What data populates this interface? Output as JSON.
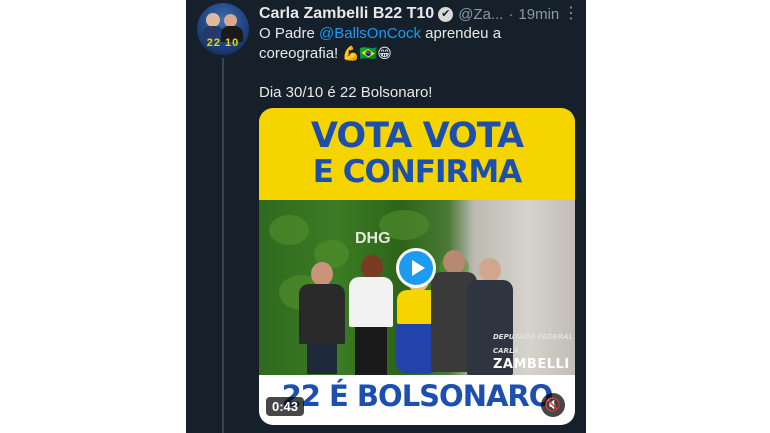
{
  "tweet": {
    "author_name": "Carla Zambelli B22 T10",
    "handle": "@Za...",
    "separator": "·",
    "time": "19min",
    "more_label": "⋮",
    "verified_glyph": "✔",
    "text_prefix": "O Padre ",
    "mention": "@BallsOnCock",
    "text_after_mention": " aprendeu a coreografia! ",
    "emojis": "💪🇧🇷😁",
    "text_line2": "Dia 30/10 é 22 Bolsonaro!"
  },
  "avatar": {
    "numbers": "22 10"
  },
  "video": {
    "banner_line1": "VOTA VOTA",
    "banner_line2": "E CONFIRMA",
    "office_sign": "DHG",
    "watermark_sub": "DEPUTADA FEDERAL CARLA",
    "watermark_main": "ZAMBELLI",
    "bottom_text": "22 É BOLSONARO",
    "duration": "0:43",
    "play_icon": "play-icon",
    "mute_icon": "speaker-muted-icon",
    "mute_glyph": "🔇"
  },
  "colors": {
    "background": "#15202b",
    "text": "#e7e9ea",
    "muted": "#8b98a5",
    "accent": "#1d9bf0",
    "banner_yellow": "#f5d400",
    "banner_blue": "#1d4fae"
  }
}
